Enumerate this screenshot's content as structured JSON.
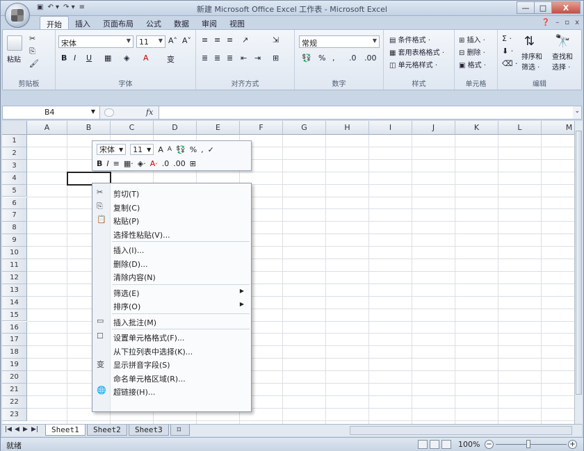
{
  "window": {
    "title": "新建 Microsoft Office Excel 工作表 - Microsoft Excel",
    "controls": {
      "minimize": "—",
      "maximize": "□",
      "close": "X"
    }
  },
  "ribbon_tabs": [
    "开始",
    "插入",
    "页面布局",
    "公式",
    "数据",
    "审阅",
    "视图"
  ],
  "ribbon": {
    "clipboard": {
      "paste": "粘贴",
      "label": "剪贴板"
    },
    "font": {
      "name": "宋体",
      "size": "11",
      "label": "字体",
      "bold": "B",
      "italic": "I",
      "underline": "U"
    },
    "alignment": {
      "label": "对齐方式"
    },
    "number": {
      "format": "常规",
      "label": "数字"
    },
    "styles": {
      "conditional": "条件格式 ·",
      "table": "套用表格格式 ·",
      "cell": "单元格样式 ·",
      "label": "样式"
    },
    "cells": {
      "insert": "插入 ·",
      "delete": "删除 ·",
      "format": "格式 ·",
      "label": "单元格"
    },
    "editing": {
      "sort": "排序和",
      "filter": "筛选 ·",
      "find": "查找和",
      "select": "选择 ·",
      "label": "编辑"
    }
  },
  "formula_bar": {
    "cell_ref": "B4",
    "fx": "fx"
  },
  "columns": [
    "A",
    "B",
    "C",
    "D",
    "E",
    "F",
    "G",
    "H",
    "I",
    "J",
    "K",
    "L",
    "M"
  ],
  "rows": [
    "1",
    "2",
    "3",
    "4",
    "5",
    "6",
    "7",
    "8",
    "9",
    "10",
    "11",
    "12",
    "13",
    "14",
    "15",
    "16",
    "17",
    "18",
    "19",
    "20",
    "21",
    "22",
    "23"
  ],
  "mini_toolbar": {
    "font": "宋体",
    "size": "11",
    "row1_icons": [
      "A",
      "A",
      "%",
      ",",
      "✓"
    ],
    "row2": [
      "B",
      "I",
      "≡"
    ]
  },
  "context_menu": [
    {
      "label": "剪切(T)",
      "icon": "✂"
    },
    {
      "label": "复制(C)",
      "icon": "⎘"
    },
    {
      "label": "粘贴(P)",
      "icon": "📋"
    },
    {
      "label": "选择性粘贴(V)..."
    },
    {
      "sep": true
    },
    {
      "label": "插入(I)..."
    },
    {
      "label": "删除(D)..."
    },
    {
      "label": "清除内容(N)"
    },
    {
      "sep": true
    },
    {
      "label": "筛选(E)",
      "sub": true
    },
    {
      "label": "排序(O)",
      "sub": true
    },
    {
      "sep": true
    },
    {
      "label": "插入批注(M)",
      "icon": "▭"
    },
    {
      "sep": true
    },
    {
      "label": "设置单元格格式(F)...",
      "icon": "☐"
    },
    {
      "label": "从下拉列表中选择(K)..."
    },
    {
      "label": "显示拼音字段(S)",
      "icon": "变"
    },
    {
      "label": "命名单元格区域(R)..."
    },
    {
      "label": "超链接(H)...",
      "icon": "🌐"
    }
  ],
  "sheets": [
    "Sheet1",
    "Sheet2",
    "Sheet3"
  ],
  "status": {
    "text": "就绪",
    "zoom": "100%"
  }
}
